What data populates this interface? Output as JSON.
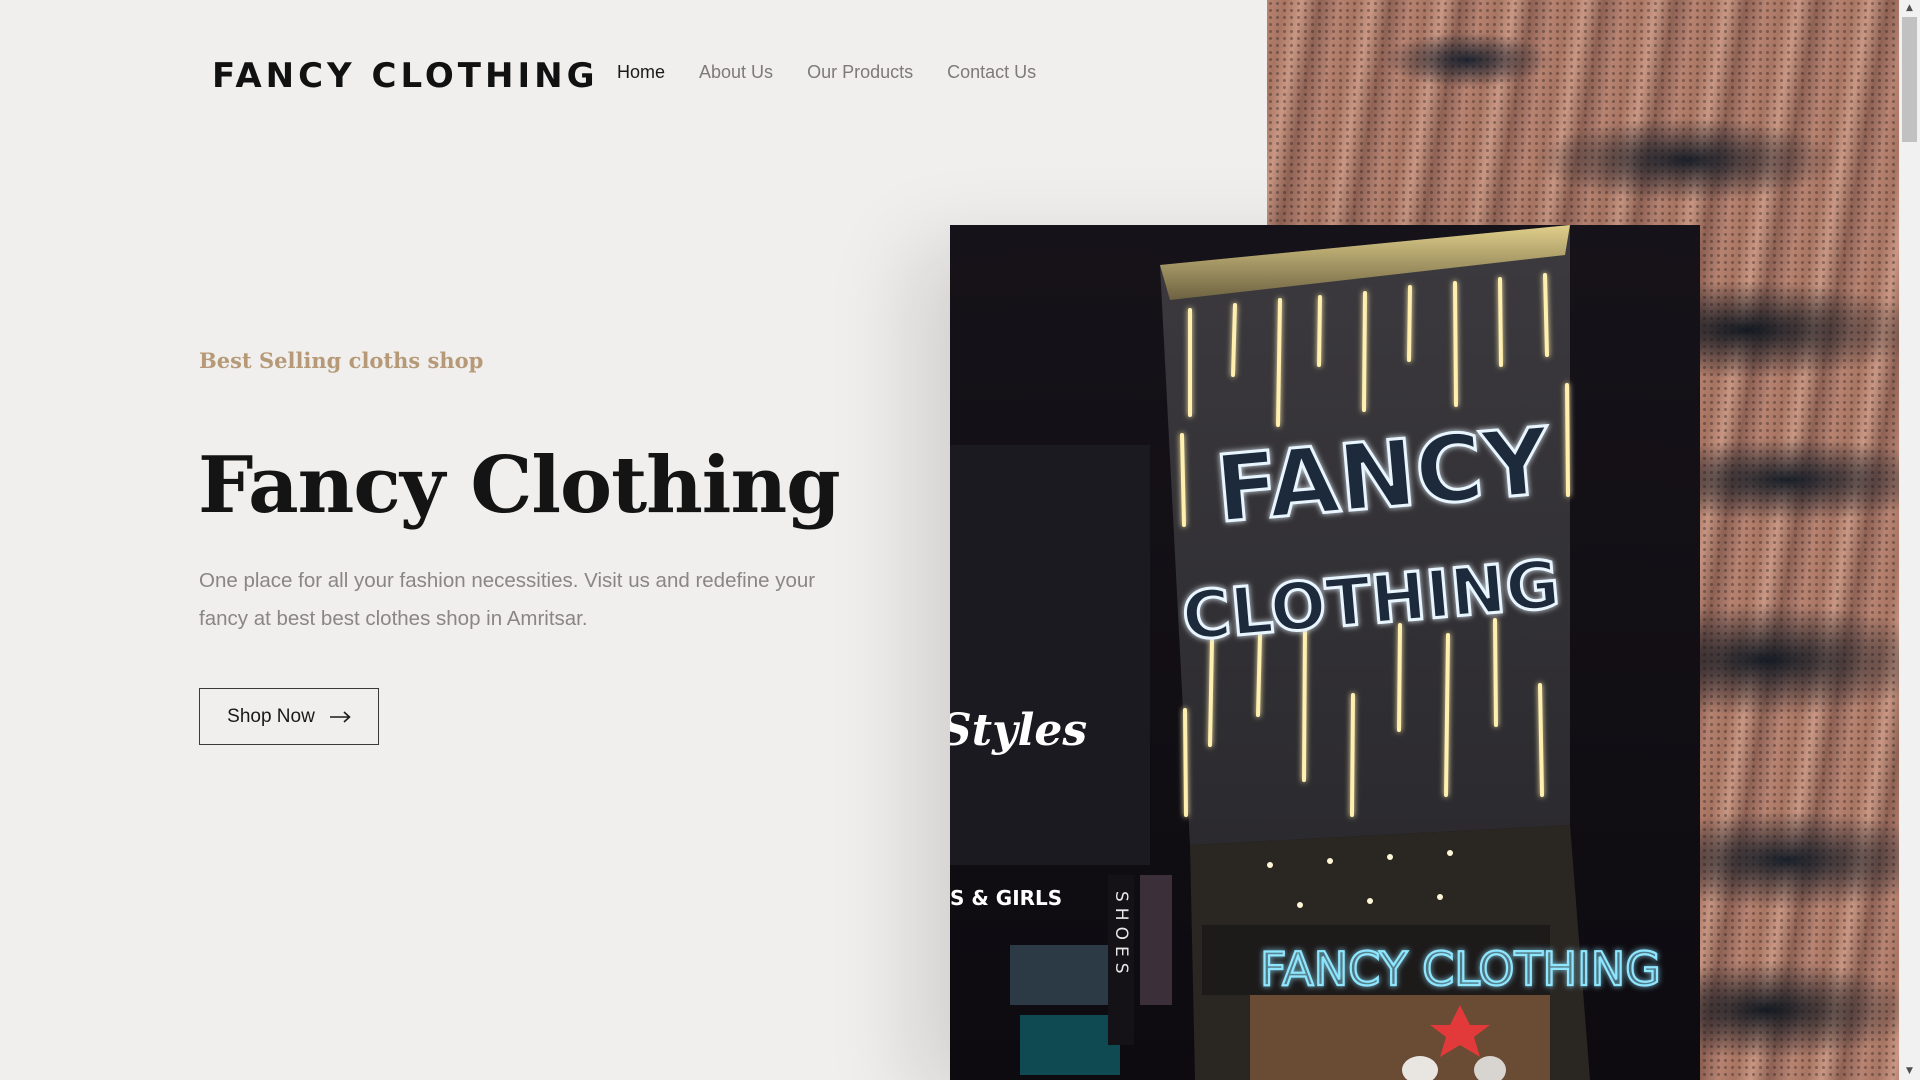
{
  "header": {
    "logo_text": "FANCY CLOTHING",
    "nav": [
      {
        "label": "Home",
        "active": true
      },
      {
        "label": "About Us",
        "active": false
      },
      {
        "label": "Our Products",
        "active": false
      },
      {
        "label": "Contact Us",
        "active": false
      }
    ]
  },
  "hero": {
    "eyebrow": "Best Selling cloths shop",
    "title": "Fancy Clothing",
    "description": "One place for all your fashion necessities. Visit us and redefine your fancy at best best clothes shop in Amritsar.",
    "button_label": "Shop Now",
    "button_icon": "arrow-right-icon"
  },
  "photo": {
    "sign_line_1": "FANCY",
    "sign_line_2": "CLOTHING",
    "lower_sign": "FANCY CLOTHING",
    "side_sign": "Styles",
    "side_sub": "S & GIRLS",
    "vertical_sign": "SHOES"
  },
  "colors": {
    "background": "#f0efee",
    "accent_gold": "#b69a78",
    "text_dark": "#141414",
    "text_muted": "#8a8683"
  }
}
